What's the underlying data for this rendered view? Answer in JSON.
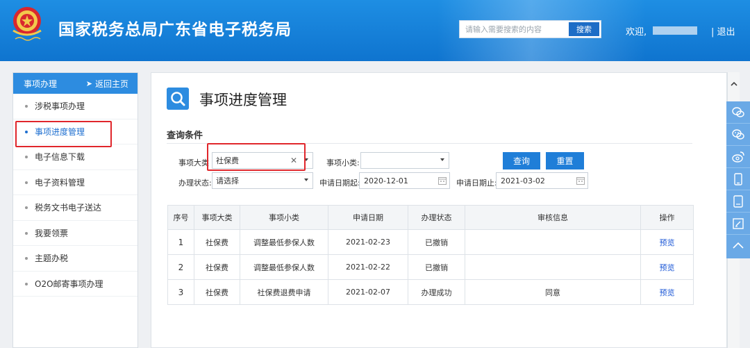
{
  "header": {
    "title": "国家税务总局广东省电子税务局",
    "search_placeholder": "请输入需要搜索的内容",
    "search_button": "搜索",
    "welcome": "欢迎,",
    "logout": "| 退出"
  },
  "sidebar": {
    "heading": "事项办理",
    "back_label": "返回主页",
    "items": [
      {
        "label": "涉税事项办理"
      },
      {
        "label": "事项进度管理"
      },
      {
        "label": "电子信息下载"
      },
      {
        "label": "电子资料管理"
      },
      {
        "label": "税务文书电子送达"
      },
      {
        "label": "我要领票"
      },
      {
        "label": "主题办税"
      },
      {
        "label": "O2O邮寄事项办理"
      }
    ],
    "active_index": 1
  },
  "main": {
    "page_title": "事项进度管理",
    "query_title": "查询条件",
    "form": {
      "category_label": "事项大类",
      "category_value": "社保费",
      "subcategory_label": "事项小类:",
      "subcategory_value": "",
      "status_label": "办理状态:",
      "status_value": "请选择",
      "date_from_label": "申请日期起:",
      "date_from_value": "2020-12-01",
      "date_to_label": "申请日期止:",
      "date_to_value": "2021-03-02",
      "query_button": "查询",
      "reset_button": "重置"
    },
    "table": {
      "headers": [
        "序号",
        "事项大类",
        "事项小类",
        "申请日期",
        "办理状态",
        "审核信息",
        "操作"
      ],
      "rows": [
        {
          "no": "1",
          "category": "社保费",
          "subcategory": "调整最低参保人数",
          "date": "2021-02-23",
          "status": "已撤销",
          "review": "",
          "action": "预览"
        },
        {
          "no": "2",
          "category": "社保费",
          "subcategory": "调整最低参保人数",
          "date": "2021-02-22",
          "status": "已撤销",
          "review": "",
          "action": "预览"
        },
        {
          "no": "3",
          "category": "社保费",
          "subcategory": "社保费退费申请",
          "date": "2021-02-07",
          "status": "办理成功",
          "review": "同意",
          "action": "预览"
        }
      ]
    }
  },
  "float_toolbar": {
    "icons": [
      "chat-bubbles-icon",
      "wechat-icon",
      "weibo-icon",
      "mobile-app-icon",
      "tablet-icon",
      "feedback-icon",
      "back-to-top-icon"
    ]
  },
  "colors": {
    "header_blue": "#1482dc",
    "accent_blue": "#1f7ed8",
    "link_blue": "#1a56d6",
    "highlight_red": "#e0262b"
  }
}
